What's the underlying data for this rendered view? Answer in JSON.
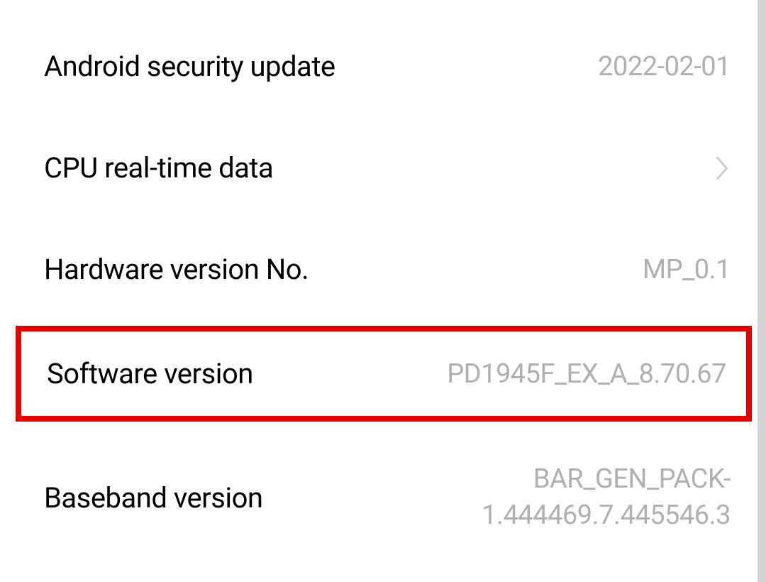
{
  "items": {
    "security_update": {
      "label": "Android security update",
      "value": "2022-02-01"
    },
    "cpu_data": {
      "label": "CPU real-time data"
    },
    "hardware_version": {
      "label": "Hardware version No.",
      "value": "MP_0.1"
    },
    "software_version": {
      "label": "Software version",
      "value": "PD1945F_EX_A_8.70.67"
    },
    "baseband_version": {
      "label": "Baseband version",
      "value": "BAR_GEN_PACK-1.444469.7.445546.3"
    }
  }
}
